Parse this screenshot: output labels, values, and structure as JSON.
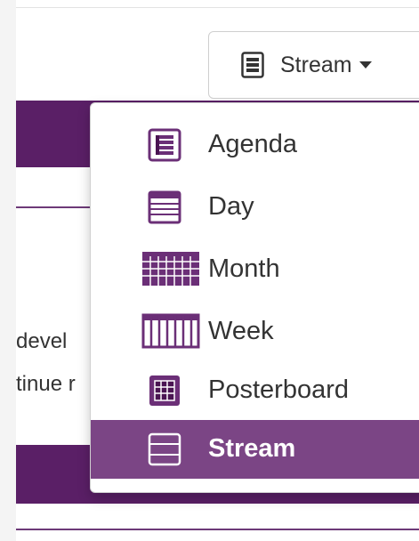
{
  "view_switcher": {
    "current_label": "Stream",
    "icon": "stream-icon"
  },
  "background_text": {
    "line1": "devel",
    "line2": "tinue r"
  },
  "menu": {
    "items": [
      {
        "label": "Agenda",
        "icon": "agenda-icon",
        "active": false
      },
      {
        "label": "Day",
        "icon": "day-icon",
        "active": false
      },
      {
        "label": "Month",
        "icon": "month-icon",
        "active": false
      },
      {
        "label": "Week",
        "icon": "week-icon",
        "active": false
      },
      {
        "label": "Posterboard",
        "icon": "posterboard-icon",
        "active": false
      },
      {
        "label": "Stream",
        "icon": "stream-icon",
        "active": true
      }
    ]
  },
  "colors": {
    "accent": "#7b4585",
    "brand_dark": "#5a1f66",
    "icon_purple": "#6b2f77"
  }
}
